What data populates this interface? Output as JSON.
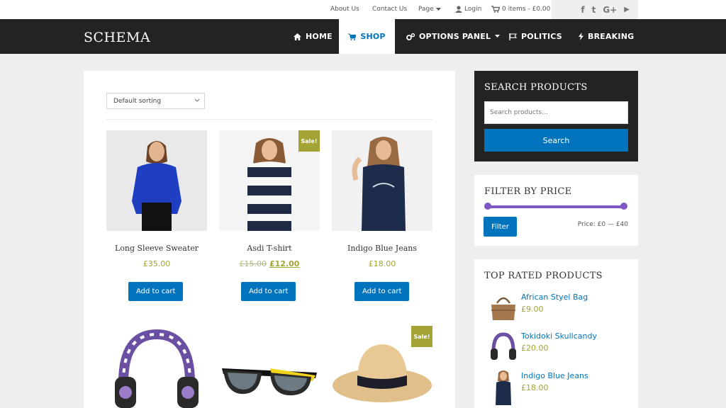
{
  "topbar": {
    "links": [
      "About Us",
      "Contact Us",
      "Page"
    ],
    "login": "Login",
    "cart": "0 items - £0.00",
    "social_icons": [
      "facebook-icon",
      "twitter-icon",
      "google-plus-icon",
      "youtube-icon"
    ],
    "social_glyphs": [
      "f",
      "t",
      "G+",
      "▶"
    ]
  },
  "header": {
    "logo": "SCHEMA",
    "nav": [
      "HOME",
      "SHOP",
      "OPTIONS PANEL",
      "POLITICS",
      "BREAKING"
    ],
    "active": "SHOP"
  },
  "shop": {
    "sorting": "Default sorting",
    "add_to_cart": "Add to cart",
    "sale_badge": "Sale!",
    "products": [
      {
        "title": "Long Sleeve Sweater",
        "price": "£35.00"
      },
      {
        "title": "Asdi T-shirt",
        "old_price": "£15.00",
        "price": "£12.00",
        "sale": true
      },
      {
        "title": "Indigo Blue Jeans",
        "price": "£18.00"
      }
    ],
    "products_row2": [
      {
        "name": "headphones"
      },
      {
        "name": "sunglasses"
      },
      {
        "name": "straw-hat",
        "sale": true
      }
    ]
  },
  "sidebar": {
    "search": {
      "title": "SEARCH PRODUCTS",
      "placeholder": "Search products…",
      "button": "Search"
    },
    "price_filter": {
      "title": "FILTER BY PRICE",
      "button": "Filter",
      "label": "Price: £0 — £40",
      "min": 0,
      "max": 40
    },
    "top_rated": {
      "title": "TOP RATED PRODUCTS",
      "items": [
        {
          "name": "African Styel Bag",
          "price": "£9.00"
        },
        {
          "name": "Tokidoki Skullcandy",
          "price": "£20.00"
        },
        {
          "name": "Indigo Blue Jeans",
          "price": "£18.00"
        }
      ]
    }
  },
  "colors": {
    "accent": "#0274be",
    "dark": "#232323",
    "price": "#a3a336",
    "slider": "#7e57c2"
  }
}
